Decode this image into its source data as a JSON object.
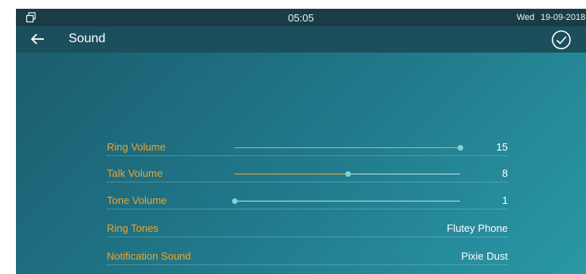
{
  "status_bar": {
    "window_icon": "window-restore-icon",
    "time": "05:05",
    "day": "Wed",
    "date": "19-09-2018"
  },
  "title_bar": {
    "back_icon": "back-arrow-icon",
    "title": "Sound",
    "confirm_icon": "checkmark-circle-icon"
  },
  "settings": {
    "ring_volume": {
      "label": "Ring Volume",
      "value": "15",
      "level": 1.0
    },
    "talk_volume": {
      "label": "Talk Volume",
      "value": "8",
      "level": 0.5
    },
    "tone_volume": {
      "label": "Tone Volume",
      "value": "1",
      "level": 0.0
    },
    "ring_tones": {
      "label": "Ring Tones",
      "value": "Flutey Phone"
    },
    "notification_sound": {
      "label": "Notification Sound",
      "value": "Pixie Dust"
    }
  },
  "colors": {
    "accent_label": "#f2a22c",
    "slider_fill": "#f0a53a",
    "slider_thumb": "#7fd8cf"
  }
}
